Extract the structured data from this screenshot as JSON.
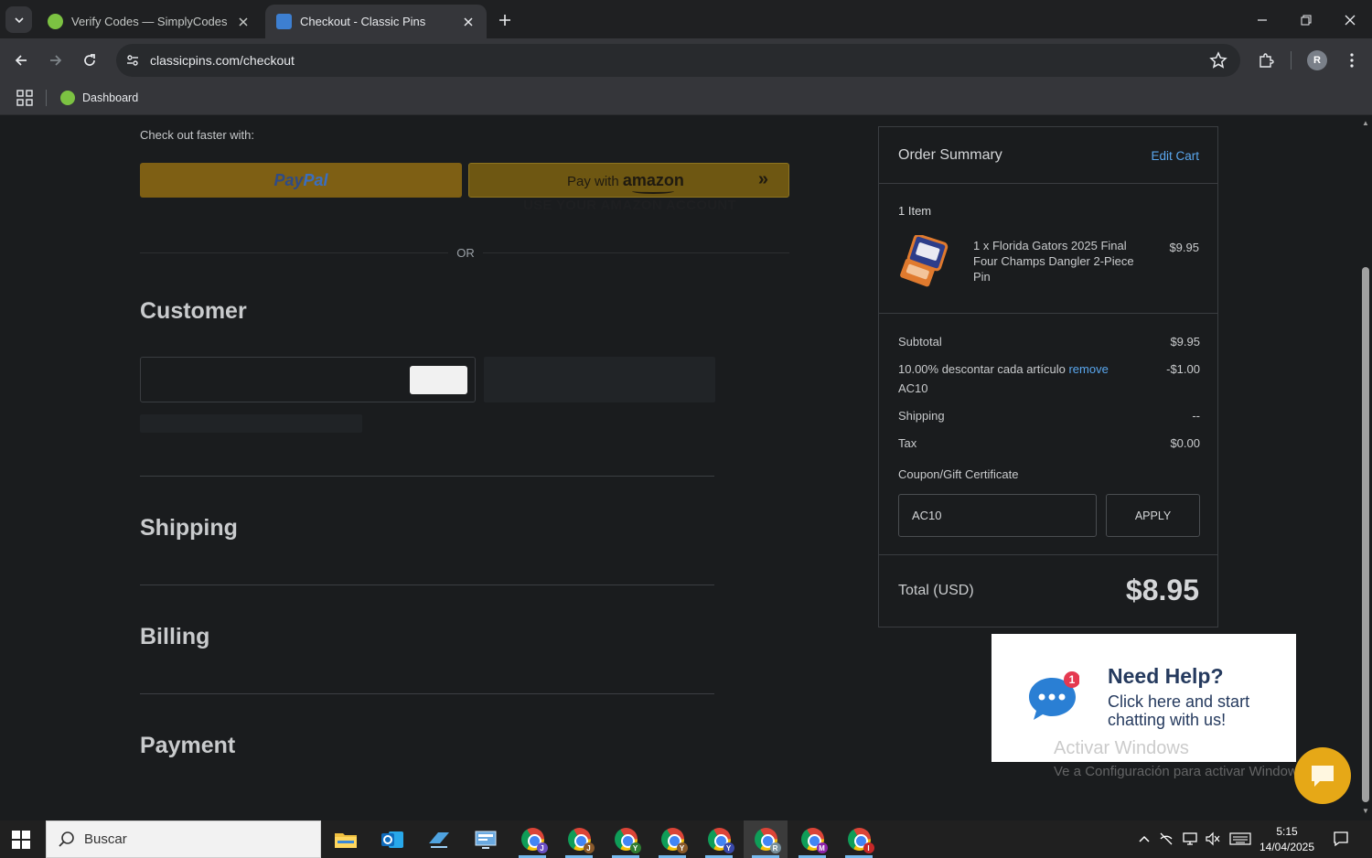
{
  "browser": {
    "tabs": [
      {
        "title": "Verify Codes — SimplyCodes",
        "active": false,
        "favicon_color": "#7cc242"
      },
      {
        "title": "Checkout - Classic Pins",
        "active": true,
        "favicon_color": "#3d7fd1"
      }
    ],
    "url": "classicpins.com/checkout",
    "bookmarks": [
      {
        "label": "Dashboard"
      }
    ],
    "profile_initial": "R"
  },
  "checkout": {
    "faster_label": "Check out faster with:",
    "paypal": {
      "pay": "Pay",
      "pal": "Pal"
    },
    "amazon": {
      "pay_with": "Pay with",
      "brand": "amazon",
      "chevrons": "»",
      "subtext": "USE YOUR AMAZON ACCOUNT"
    },
    "or_label": "OR",
    "sections": {
      "customer": "Customer",
      "shipping": "Shipping",
      "billing": "Billing",
      "payment": "Payment"
    }
  },
  "summary": {
    "title": "Order Summary",
    "edit_cart": "Edit Cart",
    "item_count": "1 Item",
    "item": {
      "name": "1 x Florida Gators 2025 Final Four Champs Dangler 2-Piece Pin",
      "price": "$9.95"
    },
    "subtotal": {
      "label": "Subtotal",
      "value": "$9.95"
    },
    "discount": {
      "label": "10.00% descontar cada artículo",
      "remove": "remove",
      "code": "AC10",
      "value": "-$1.00"
    },
    "shipping": {
      "label": "Shipping",
      "value": "--"
    },
    "tax": {
      "label": "Tax",
      "value": "$0.00"
    },
    "coupon": {
      "label": "Coupon/Gift Certificate",
      "value": "AC10",
      "apply": "APPLY"
    },
    "total": {
      "label": "Total (USD)",
      "value": "$8.95"
    }
  },
  "help_widget": {
    "badge": "1",
    "title": "Need Help?",
    "subtitle": "Click here and start chatting with us!"
  },
  "watermark": {
    "line1": "Activar Windows",
    "line2": "Ve a Configuración para activar Windows."
  },
  "taskbar": {
    "search_placeholder": "Buscar",
    "chrome_profiles": [
      {
        "letter": "J",
        "color": "#6a4fc3"
      },
      {
        "letter": "J",
        "color": "#8a5a2b"
      },
      {
        "letter": "Y",
        "color": "#2e7d32"
      },
      {
        "letter": "Y",
        "color": "#8a5a2b"
      },
      {
        "letter": "Y",
        "color": "#3949ab"
      },
      {
        "letter": "R",
        "color": "#78909c"
      },
      {
        "letter": "M",
        "color": "#8e24aa"
      },
      {
        "letter": "I",
        "color": "#c62828"
      }
    ],
    "time": "5:15",
    "date": "14/04/2025"
  }
}
